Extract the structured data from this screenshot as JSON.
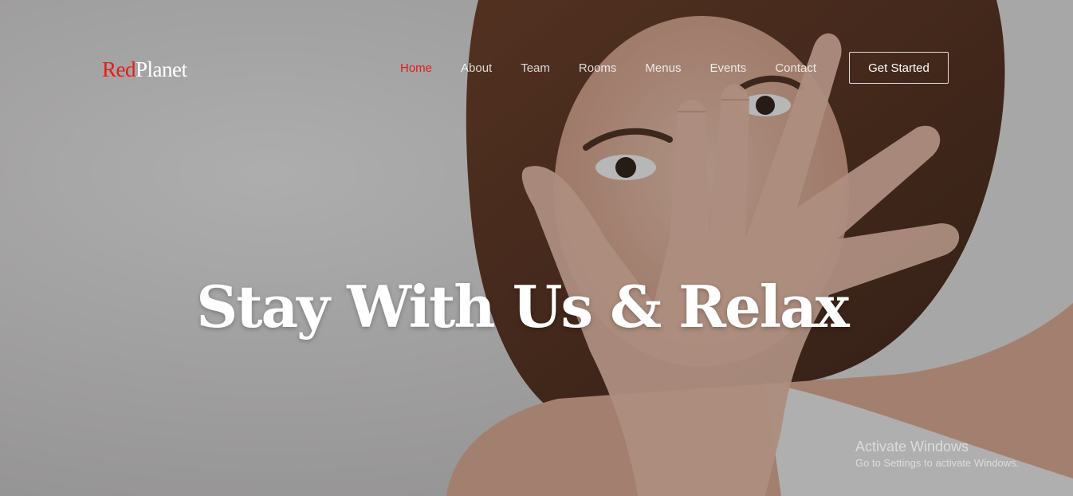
{
  "brand": {
    "name_part1": "Red",
    "name_part2": "Planet",
    "accent_color": "#e61b1b"
  },
  "nav": {
    "items": [
      {
        "label": "Home",
        "active": true
      },
      {
        "label": "About",
        "active": false
      },
      {
        "label": "Team",
        "active": false
      },
      {
        "label": "Rooms",
        "active": false
      },
      {
        "label": "Menus",
        "active": false
      },
      {
        "label": "Events",
        "active": false
      },
      {
        "label": "Contact",
        "active": false
      }
    ],
    "cta_label": "Get Started"
  },
  "hero": {
    "headline": "Stay With Us & Relax",
    "image": "photo of a woman in bed covering her face with her hands, peeking through her fingers"
  },
  "watermark": {
    "title": "Activate Windows",
    "subtitle": "Go to Settings to activate Windows."
  }
}
